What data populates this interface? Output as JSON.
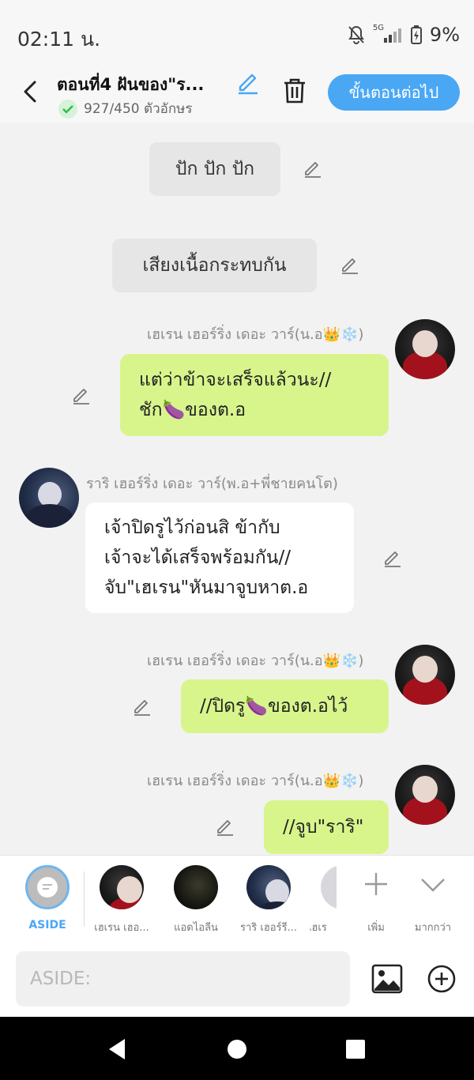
{
  "status_bar": {
    "time": "02:11 น.",
    "battery": "9%",
    "network": "5G"
  },
  "header": {
    "title": "ตอนที่4 ฝันของ\"ร...",
    "char_count": "927/450 ตัวอักษร",
    "next_label": "ขั้นตอนต่อไป"
  },
  "messages": {
    "aside1": "ปัก ปัก ปัก",
    "aside2": "เสียงเนื้อกระทบกัน",
    "m1_name": "เฮเรน เฮอร์ริ่ง เดอะ วาร์(น.อ👑❄️)",
    "m1_text": "แต่ว่าข้าจะเสร็จแล้วนะ//\nชัก🍆ของต.อ",
    "m2_name": "ราริ เฮอร์ริ่ง เดอะ วาร์(พ.อ+พี่ชายคนโต)",
    "m2_text": "เจ้าปิดรูไว้ก่อนสิ ข้ากับ\nเจ้าจะได้เสร็จพร้อมกัน//\nจับ\"เฮเรน\"หันมาจูบหาต.อ",
    "m3_name": "เฮเรน เฮอร์ริ่ง เดอะ วาร์(น.อ👑❄️)",
    "m3_text": "//ปิดรู🍆ของต.อไว้",
    "m4_name": "เฮเรน เฮอร์ริ่ง เดอะ วาร์(น.อ👑❄️)",
    "m4_text": "//จูบ\"ราริ\""
  },
  "characters": {
    "aside": "ASIDE",
    "c1": "เฮเรน เฮอ...",
    "c2": "แอดไอลีน",
    "c3": "ราริ เฮอร์รี...",
    "c4": "เฮเร",
    "add": "เพิ่ม",
    "more": "มากกว่า"
  },
  "input": {
    "placeholder": "ASIDE:"
  },
  "colors": {
    "accent": "#4aa7f4",
    "bubble_right": "#d8f58c",
    "bubble_left": "#ffffff"
  }
}
